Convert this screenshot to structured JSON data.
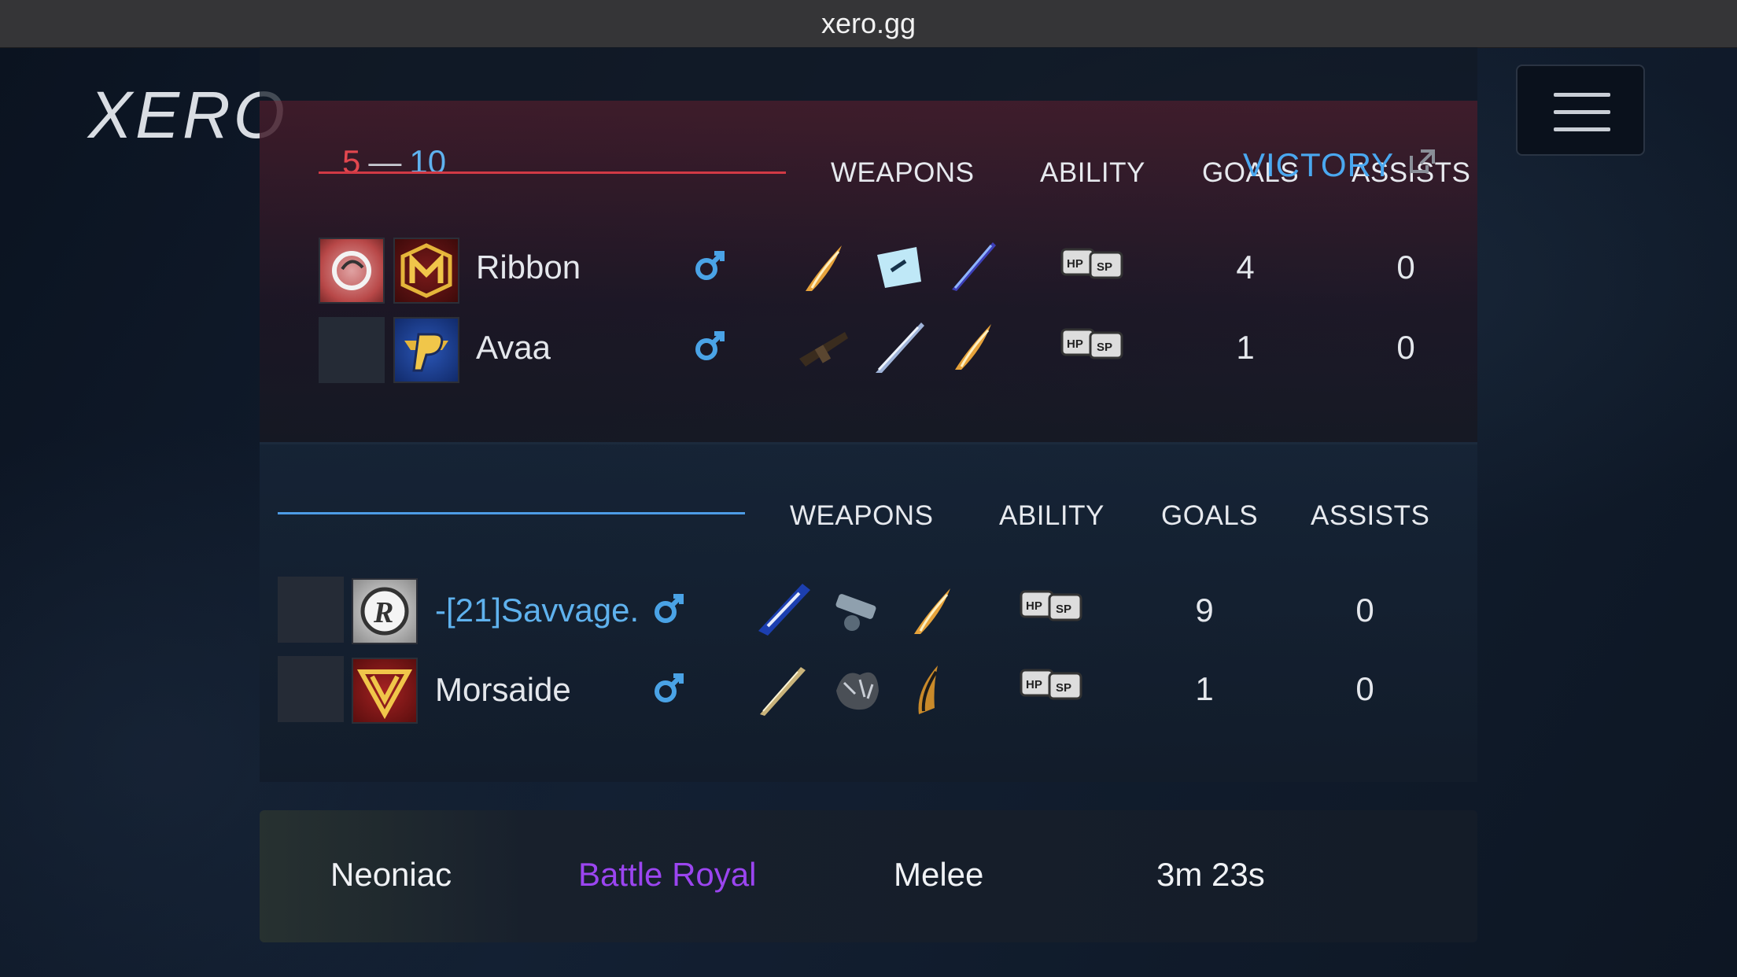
{
  "browser": {
    "url": "xero.gg"
  },
  "brand": {
    "logo_text": "XERO"
  },
  "match": {
    "score_red": "5",
    "score_dash": "—",
    "score_blue": "10",
    "result": "VICTORY"
  },
  "headers": {
    "weapons": "WEAPONS",
    "ability": "ABILITY",
    "goals": "GOALS",
    "assists": "ASSISTS"
  },
  "team_red": {
    "players": [
      {
        "name": "Ribbon",
        "goals": "4",
        "assists": "0",
        "ability_icon": "hp-sp-icon"
      },
      {
        "name": "Avaa",
        "goals": "1",
        "assists": "0",
        "ability_icon": "hp-sp-icon"
      }
    ]
  },
  "team_blue": {
    "players": [
      {
        "name": "-[21]Savvage.",
        "goals": "9",
        "assists": "0",
        "ability_icon": "hp-sp-icon"
      },
      {
        "name": "Morsaide",
        "goals": "1",
        "assists": "0",
        "ability_icon": "hp-sp-icon"
      }
    ]
  },
  "footer": {
    "map": "Neoniac",
    "mode": "Battle Royal",
    "type": "Melee",
    "duration": "3m 23s"
  },
  "colors": {
    "red_team": "#e3474f",
    "blue_team": "#5fb2ee",
    "mode_purple": "#9b45f0",
    "victory": "#4aa8f0"
  }
}
